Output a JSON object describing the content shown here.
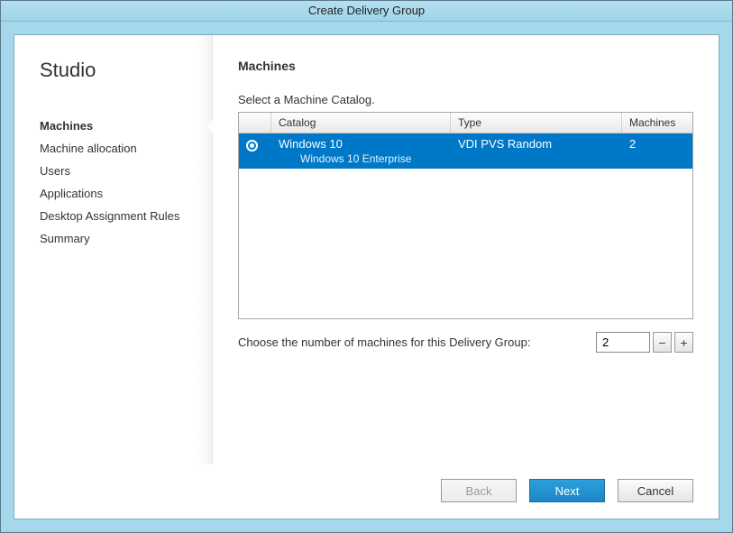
{
  "window": {
    "title": "Create Delivery Group"
  },
  "app": {
    "name": "Studio"
  },
  "nav": {
    "items": [
      {
        "label": "Machines",
        "active": true
      },
      {
        "label": "Machine allocation"
      },
      {
        "label": "Users"
      },
      {
        "label": "Applications"
      },
      {
        "label": "Desktop Assignment Rules"
      },
      {
        "label": "Summary"
      }
    ]
  },
  "page": {
    "heading": "Machines",
    "instruction": "Select a Machine Catalog."
  },
  "grid": {
    "columns": {
      "catalog": "Catalog",
      "type": "Type",
      "machines": "Machines"
    },
    "rows": [
      {
        "selected": true,
        "catalog": "Windows 10",
        "sublabel": "Windows 10 Enterprise",
        "type": "VDI PVS Random",
        "machines": "2"
      }
    ]
  },
  "chooser": {
    "label": "Choose the number of machines for this Delivery Group:",
    "value": "2",
    "minus": "−",
    "plus": "+"
  },
  "buttons": {
    "back": "Back",
    "next": "Next",
    "cancel": "Cancel"
  }
}
